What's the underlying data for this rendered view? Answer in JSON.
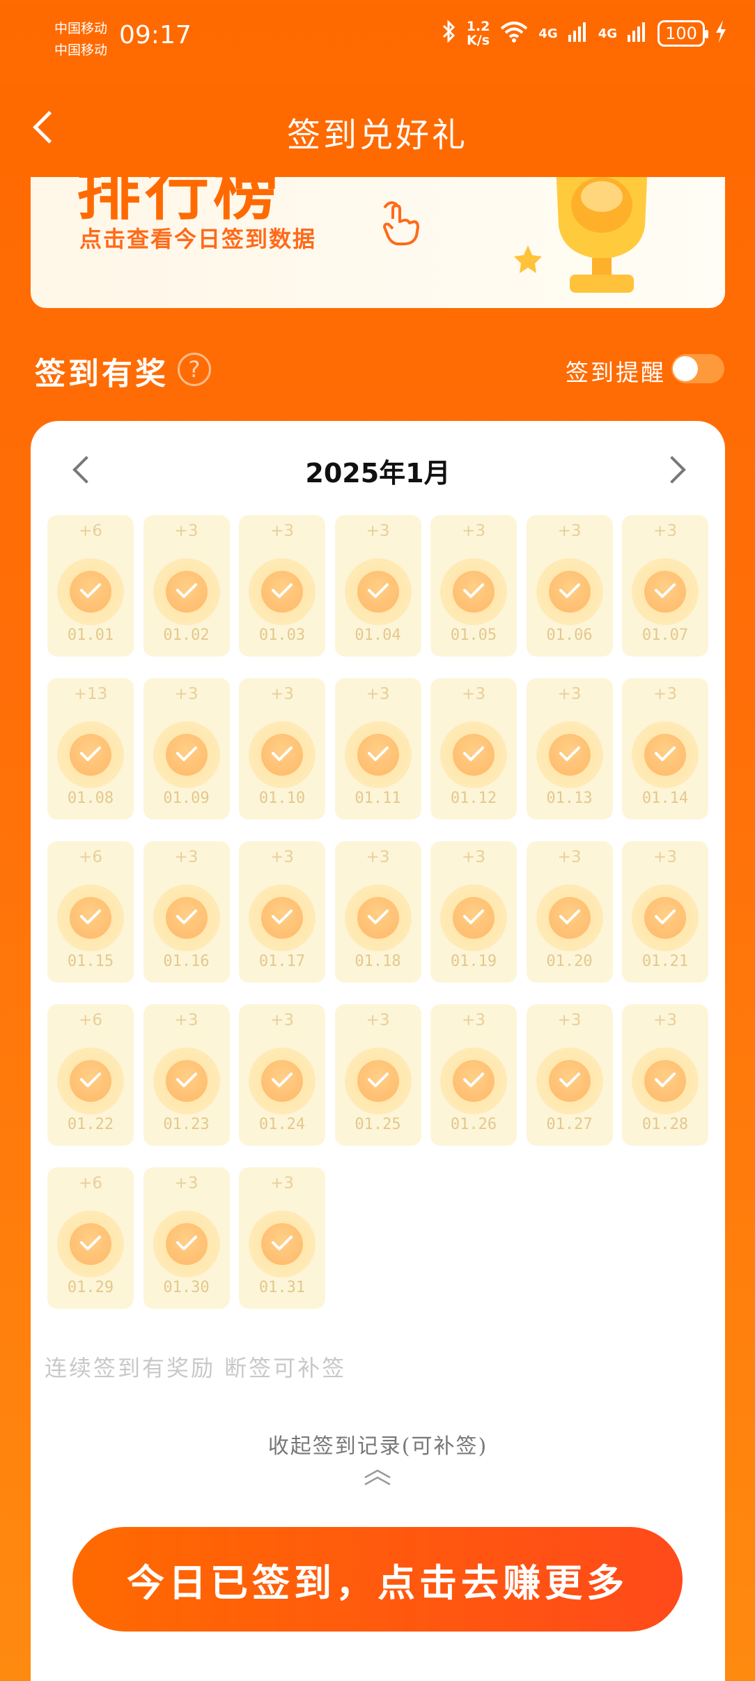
{
  "status": {
    "carrier1": "中国移动",
    "carrier2": "中国移动",
    "time": "09:17",
    "speed_value": "1.2",
    "speed_unit": "K/s",
    "net1": "4G",
    "net2": "4G",
    "battery": "100"
  },
  "header": {
    "title": "签到兑好礼"
  },
  "banner": {
    "big_text": "排行榜",
    "subtitle": "点击查看今日签到数据"
  },
  "section": {
    "title": "签到有奖",
    "help": "?",
    "reminder_label": "签到提醒",
    "reminder_on": false
  },
  "calendar": {
    "month": "2025年1月",
    "days": [
      {
        "bonus": "+6",
        "date": "01.01"
      },
      {
        "bonus": "+3",
        "date": "01.02"
      },
      {
        "bonus": "+3",
        "date": "01.03"
      },
      {
        "bonus": "+3",
        "date": "01.04"
      },
      {
        "bonus": "+3",
        "date": "01.05"
      },
      {
        "bonus": "+3",
        "date": "01.06"
      },
      {
        "bonus": "+3",
        "date": "01.07"
      },
      {
        "bonus": "+13",
        "date": "01.08"
      },
      {
        "bonus": "+3",
        "date": "01.09"
      },
      {
        "bonus": "+3",
        "date": "01.10"
      },
      {
        "bonus": "+3",
        "date": "01.11"
      },
      {
        "bonus": "+3",
        "date": "01.12"
      },
      {
        "bonus": "+3",
        "date": "01.13"
      },
      {
        "bonus": "+3",
        "date": "01.14"
      },
      {
        "bonus": "+6",
        "date": "01.15"
      },
      {
        "bonus": "+3",
        "date": "01.16"
      },
      {
        "bonus": "+3",
        "date": "01.17"
      },
      {
        "bonus": "+3",
        "date": "01.18"
      },
      {
        "bonus": "+3",
        "date": "01.19"
      },
      {
        "bonus": "+3",
        "date": "01.20"
      },
      {
        "bonus": "+3",
        "date": "01.21"
      },
      {
        "bonus": "+6",
        "date": "01.22"
      },
      {
        "bonus": "+3",
        "date": "01.23"
      },
      {
        "bonus": "+3",
        "date": "01.24"
      },
      {
        "bonus": "+3",
        "date": "01.25"
      },
      {
        "bonus": "+3",
        "date": "01.26"
      },
      {
        "bonus": "+3",
        "date": "01.27"
      },
      {
        "bonus": "+3",
        "date": "01.28"
      },
      {
        "bonus": "+6",
        "date": "01.29"
      },
      {
        "bonus": "+3",
        "date": "01.30"
      },
      {
        "bonus": "+3",
        "date": "01.31"
      }
    ]
  },
  "rule_text": "连续签到有奖励 断签可补签",
  "collapse_text": "收起签到记录(可补签)",
  "cta_label": "今日已签到，点击去赚更多",
  "colors": {
    "primary": "#ff6a00",
    "cell_bg": "#fdf5d8",
    "check_coin": "#ffb869"
  }
}
